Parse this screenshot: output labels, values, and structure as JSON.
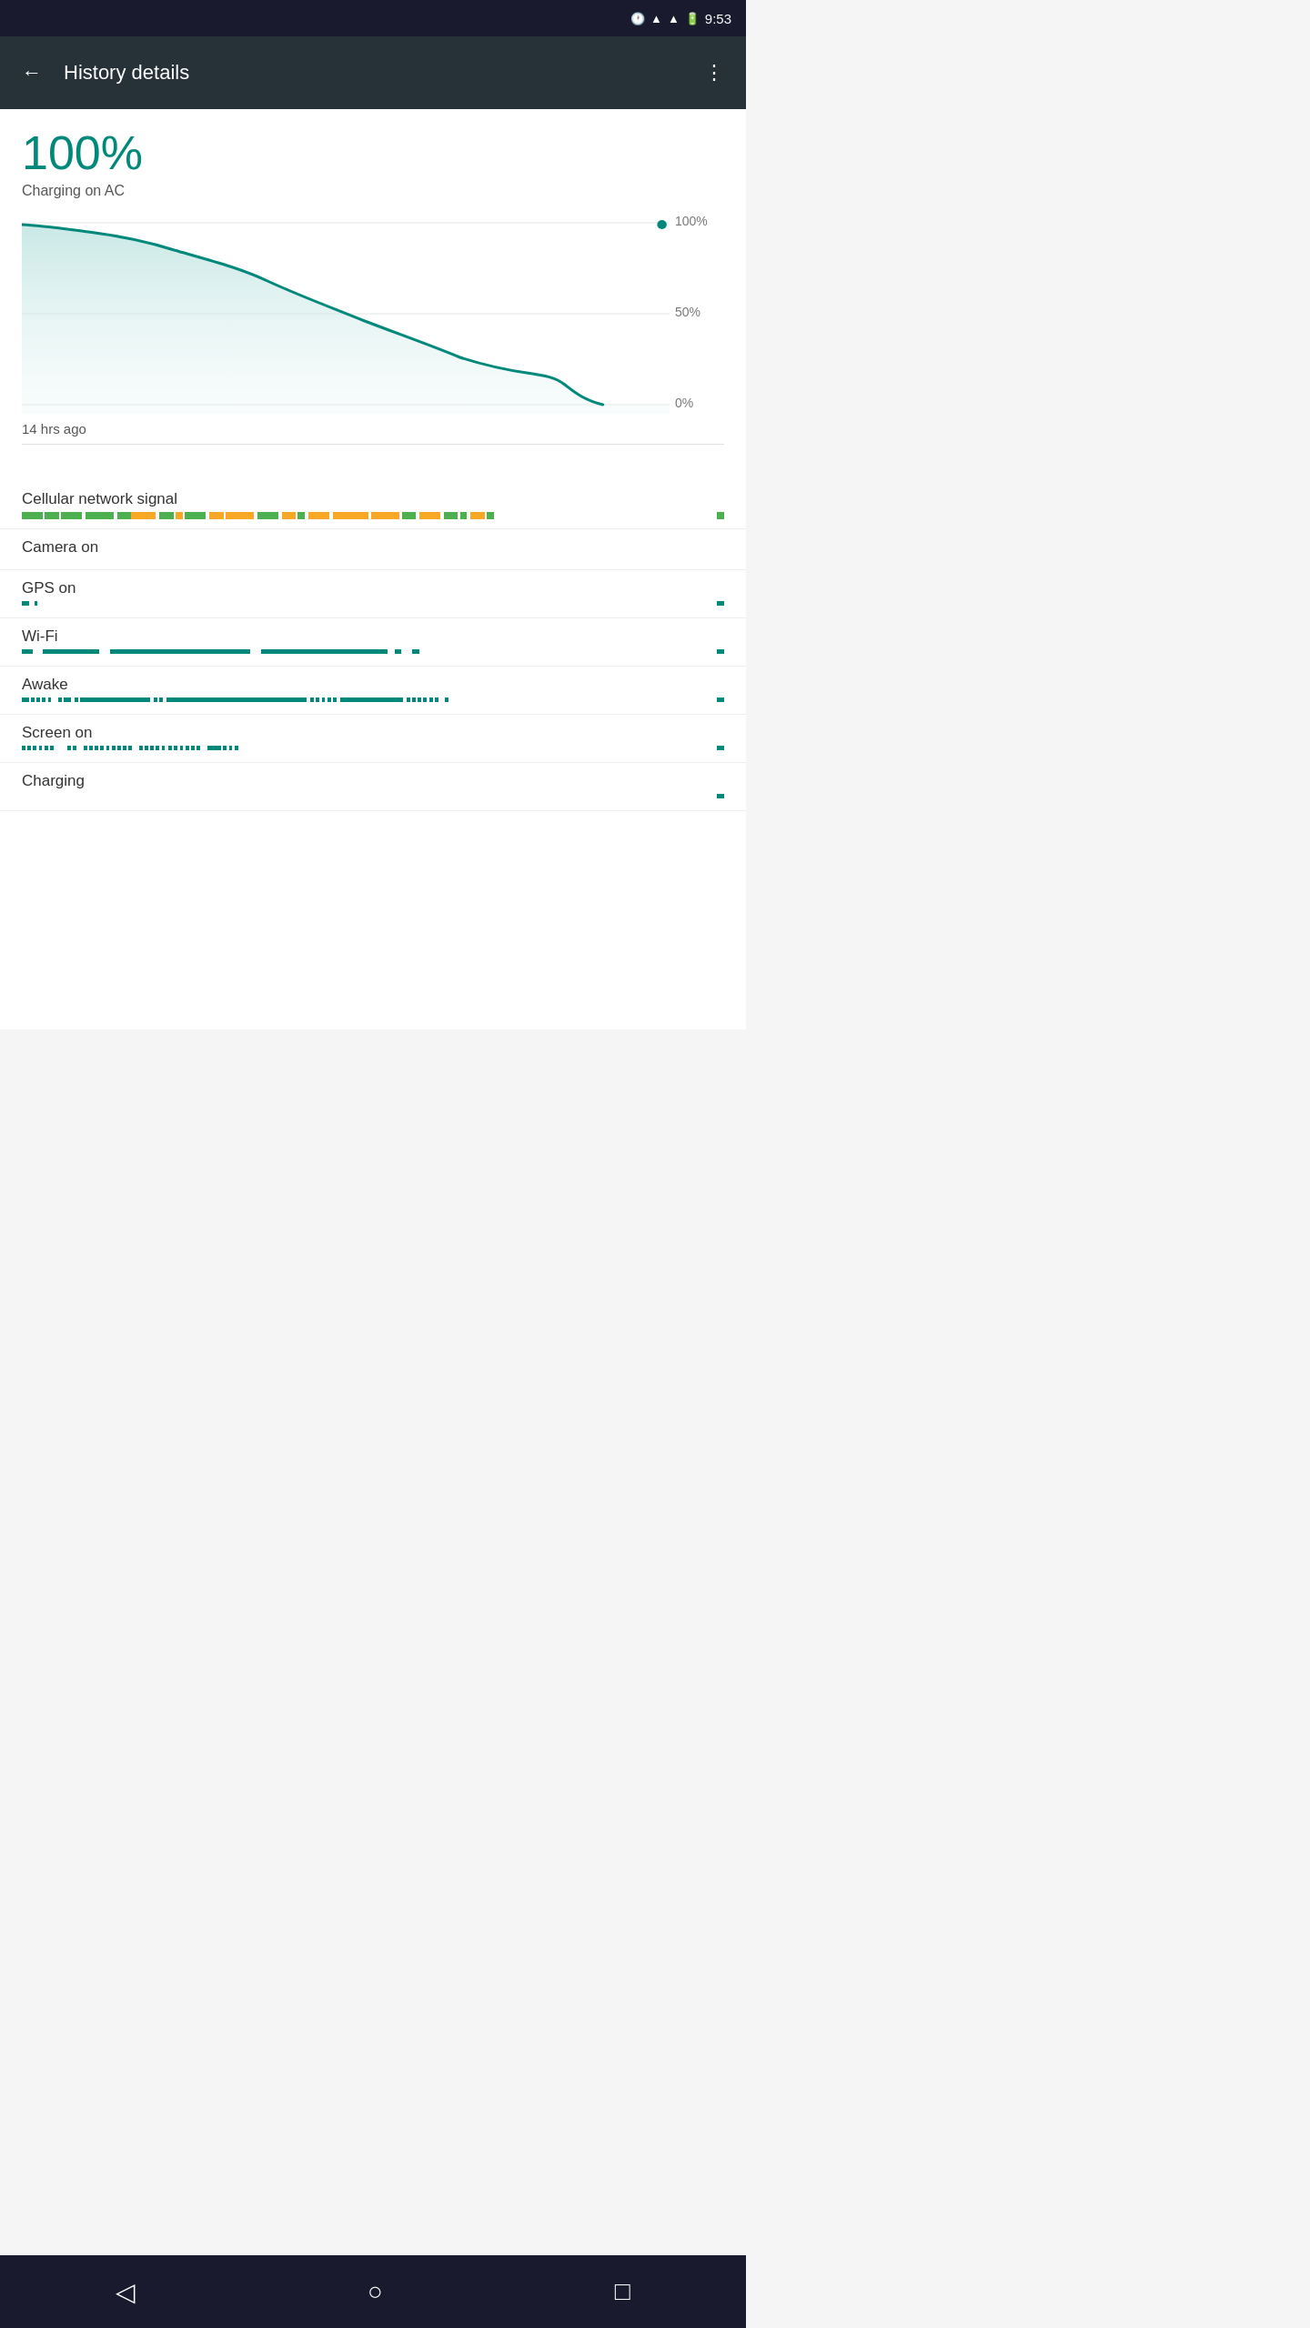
{
  "statusBar": {
    "time": "9:53",
    "icons": [
      "clock",
      "wifi",
      "signal",
      "battery"
    ]
  },
  "appBar": {
    "title": "History details",
    "backLabel": "←",
    "menuLabel": "⋮"
  },
  "main": {
    "batteryPercent": "100%",
    "chargingStatus": "Charging on AC",
    "chartLabels": {
      "top": "100%",
      "mid": "50%",
      "bot": "0%"
    },
    "timeAgo": "14 hrs ago",
    "sensors": [
      {
        "label": "Cellular network signal",
        "type": "cellular"
      },
      {
        "label": "Camera on",
        "type": "none"
      },
      {
        "label": "GPS on",
        "type": "gps"
      },
      {
        "label": "Wi-Fi",
        "type": "wifi"
      },
      {
        "label": "Awake",
        "type": "awake"
      },
      {
        "label": "Screen on",
        "type": "screenon"
      },
      {
        "label": "Charging",
        "type": "charging"
      }
    ]
  },
  "navBar": {
    "back": "◁",
    "home": "○",
    "recent": "□"
  }
}
